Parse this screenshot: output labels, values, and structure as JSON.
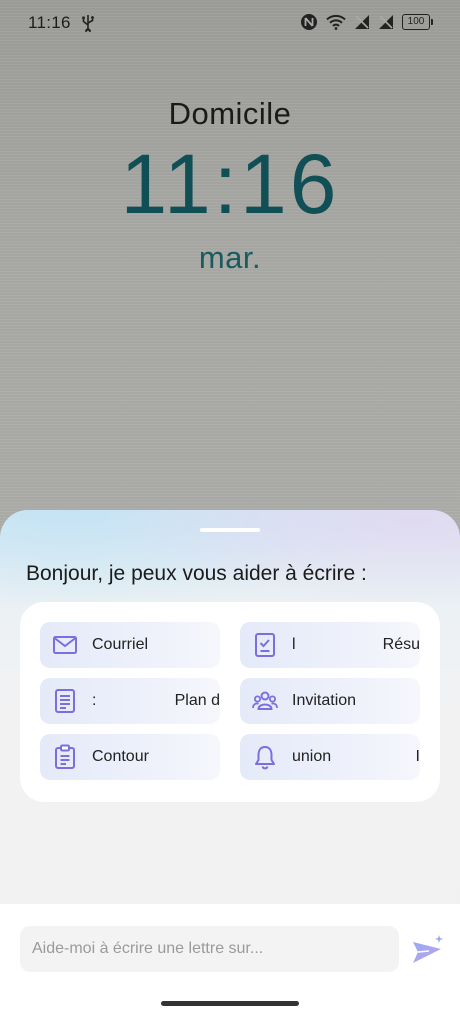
{
  "status_bar": {
    "time": "11:16",
    "battery": "100"
  },
  "lock_clock": {
    "location": "Domicile",
    "time": "11:16",
    "day": "mar."
  },
  "assistant": {
    "greeting": "Bonjour, je peux vous aider à écrire :",
    "chips": [
      {
        "label": "Courriel",
        "label2": "",
        "icon": "envelope-icon"
      },
      {
        "label": "l",
        "label2": "Résu",
        "icon": "checklist-icon"
      },
      {
        "label": ":",
        "label2": "Plan d",
        "icon": "document-lines-icon"
      },
      {
        "label": "Invitation",
        "label2": "",
        "icon": "people-icon"
      },
      {
        "label": "Contour",
        "label2": "",
        "icon": "clipboard-icon"
      },
      {
        "label": "union",
        "label2": "I",
        "icon": "bell-icon"
      }
    ],
    "input_placeholder": "Aide-moi à écrire une lettre sur...",
    "accent": "#7b6fe0"
  }
}
